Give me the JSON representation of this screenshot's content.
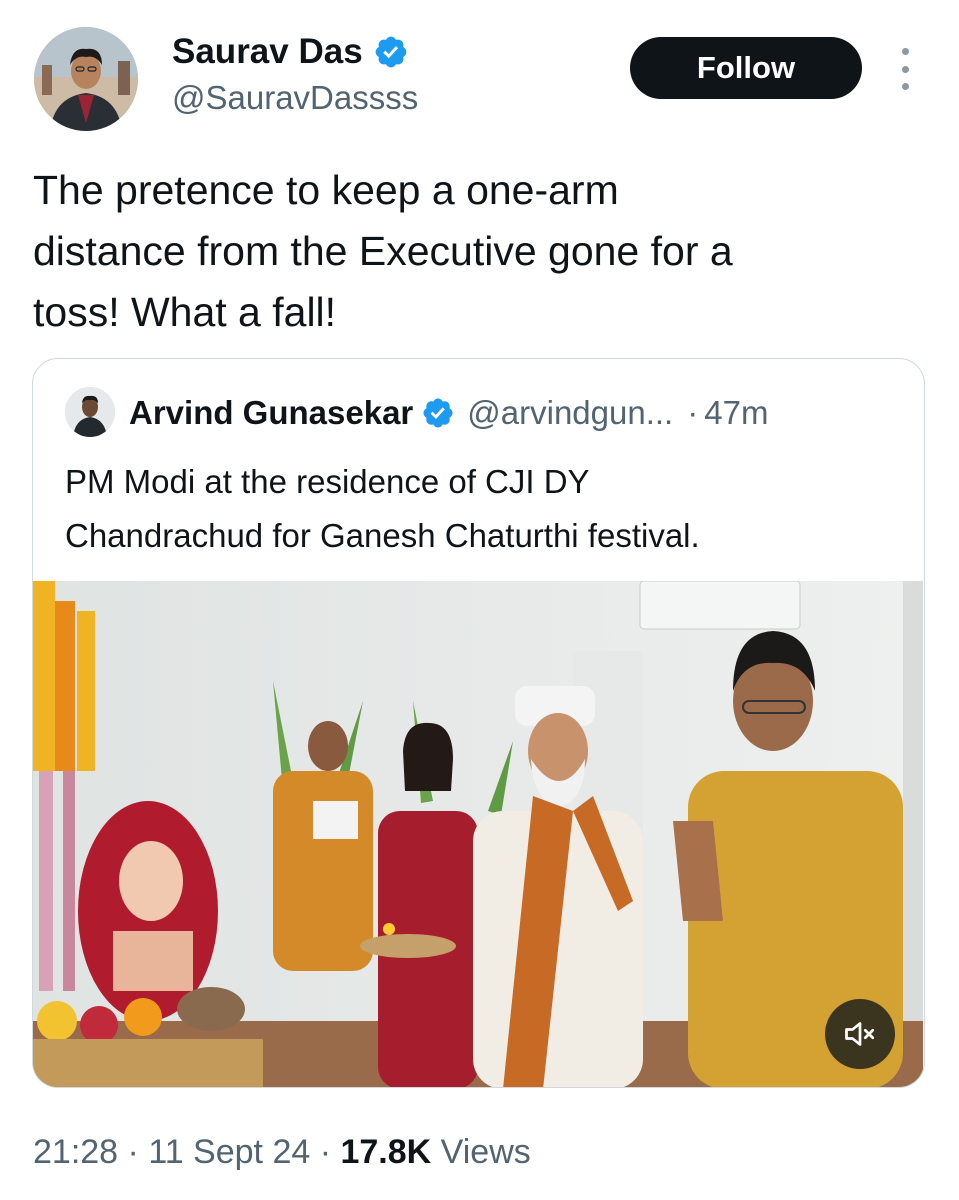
{
  "author": {
    "name": "Saurav Das",
    "handle": "@SauravDassss",
    "verified_icon": "verified-badge-icon"
  },
  "follow_label": "Follow",
  "more_icon": "more-options-icon",
  "tweet_text": "The pretence to keep a one-arm\ndistance from the Executive gone for a\ntoss! What a fall!",
  "quoted": {
    "name": "Arvind Gunasekar",
    "handle": "@arvindgun...",
    "separator": "·",
    "time": "47m",
    "text": "PM Modi at the residence of CJI DY\nChandrachud for Ganesh Chaturthi festival.",
    "mute_icon": "speaker-muted-icon"
  },
  "meta": {
    "time": "21:28",
    "sep1": " · ",
    "date": "11 Sept 24",
    "sep2": " · ",
    "views_count": "17.8K",
    "views_label": " Views"
  },
  "colors": {
    "accent_blue": "#1d9bf0",
    "text_primary": "#0f1419",
    "text_secondary": "#536471",
    "border": "#cfd9de",
    "follow_bg": "#0f1419"
  }
}
